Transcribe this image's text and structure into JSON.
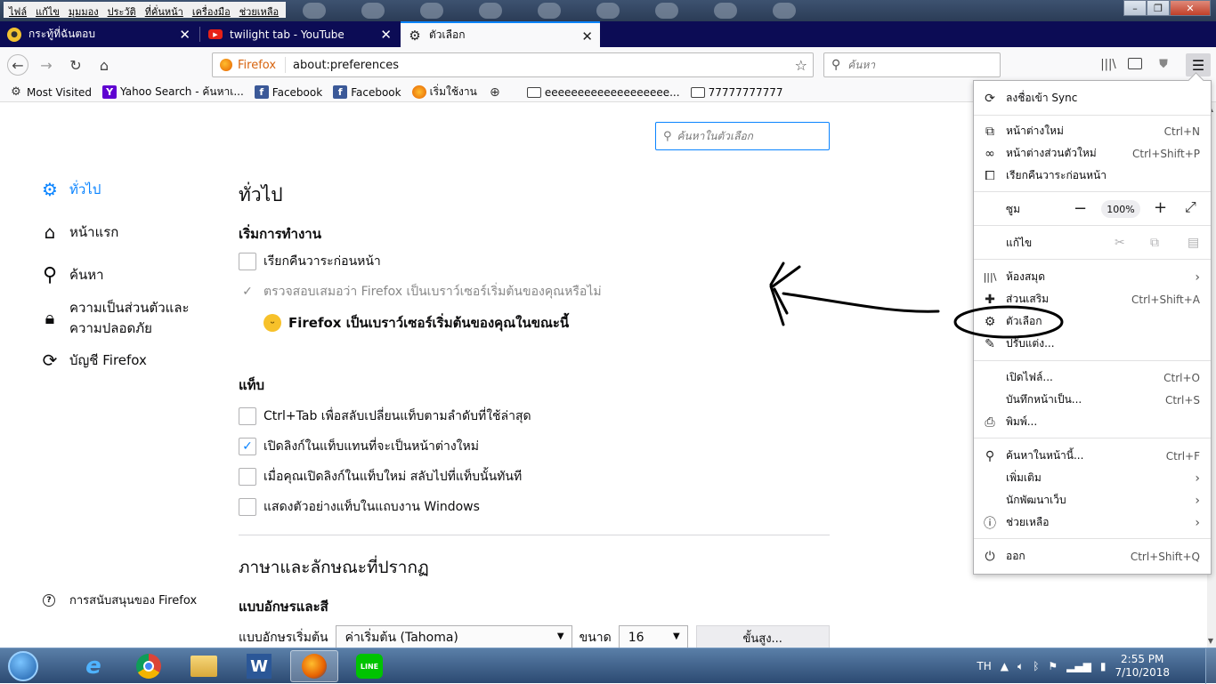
{
  "menubar": {
    "items": [
      "ไฟล์",
      "แก้ไข",
      "มุมมอง",
      "ประวัติ",
      "ที่คั่นหน้า",
      "เครื่องมือ",
      "ช่วยเหลือ"
    ]
  },
  "window_controls": {
    "minimize": "–",
    "maximize": "❐",
    "close": "✕"
  },
  "tabs": [
    {
      "label": "กระทู้ที่ฉันตอบ"
    },
    {
      "label": "twilight tab - YouTube"
    },
    {
      "label": "ตัวเลือก"
    }
  ],
  "newtab_label": "+",
  "navbar": {
    "identity_label": "Firefox",
    "url": "about:preferences",
    "search_placeholder": "ค้นหา"
  },
  "bookmarks": [
    {
      "label": "Most Visited",
      "icon": "gear-icon"
    },
    {
      "label": "Yahoo Search - ค้นหาเ...",
      "icon": "yahoo-icon"
    },
    {
      "label": "Facebook",
      "icon": "facebook-icon"
    },
    {
      "label": "Facebook",
      "icon": "facebook-icon"
    },
    {
      "label": "เริ่มใช้งาน",
      "icon": "firefox-icon"
    },
    {
      "label": "",
      "icon": "globe-icon"
    },
    {
      "label": "eeeeeeeeeeeeeeeeeee...",
      "icon": "folder-icon"
    },
    {
      "label": "77777777777",
      "icon": "folder-icon"
    }
  ],
  "prefs": {
    "search_placeholder": "ค้นหาในตัวเลือก",
    "categories": [
      {
        "label": "ทั่วไป",
        "selected": true
      },
      {
        "label": "หน้าแรก"
      },
      {
        "label": "ค้นหา"
      },
      {
        "label": "ความเป็นส่วนตัวและ\nความปลอดภัย"
      },
      {
        "label": "บัญชี Firefox"
      }
    ],
    "support_label": "การสนับสนุนของ Firefox",
    "heading": "ทั่วไป",
    "startup_heading": "เริ่มการทำงาน",
    "startup_options": [
      {
        "label": "เรียกคืนวาระก่อนหน้า",
        "checked": false
      },
      {
        "label": "ตรวจสอบเสมอว่า Firefox เป็นเบราว์เซอร์เริ่มต้นของคุณหรือไม่",
        "checked": true,
        "disabled": true
      }
    ],
    "default_msg": "Firefox เป็นเบราว์เซอร์เริ่มต้นของคุณในขณะนี้",
    "tabs_heading": "แท็บ",
    "tabs_options": [
      {
        "label": "Ctrl+Tab เพื่อสลับเปลี่ยนแท็บตามลำดับที่ใช้ล่าสุด",
        "checked": false
      },
      {
        "label": "เปิดลิงก์ในแท็บแทนที่จะเป็นหน้าต่างใหม่",
        "checked": true
      },
      {
        "label": "เมื่อคุณเปิดลิงก์ในแท็บใหม่ สลับไปที่แท็บนั้นทันที",
        "checked": false
      },
      {
        "label": "แสดงตัวอย่างแท็บในแถบงาน Windows",
        "checked": false
      }
    ],
    "lang_heading": "ภาษาและลักษณะที่ปรากฏ",
    "fonts_heading": "แบบอักษรและสี",
    "font_label": "แบบอักษรเริ่มต้น",
    "font_value": "ค่าเริ่มต้น (Tahoma)",
    "size_label": "ขนาด",
    "size_value": "16",
    "advanced_label": "ขั้นสูง..."
  },
  "appmenu": {
    "sync": "ลงชื่อเข้า Sync",
    "new_window": {
      "label": "หน้าต่างใหม่",
      "shortcut": "Ctrl+N"
    },
    "private_window": {
      "label": "หน้าต่างส่วนตัวใหม่",
      "shortcut": "Ctrl+Shift+P"
    },
    "restore": "เรียกคืนวาระก่อนหน้า",
    "zoom_label": "ซูม",
    "zoom_value": "100%",
    "edit_label": "แก้ไข",
    "library": "ห้องสมุด",
    "addons": {
      "label": "ส่วนเสริม",
      "shortcut": "Ctrl+Shift+A"
    },
    "options": "ตัวเลือก",
    "customize": "ปรับแต่ง...",
    "open_file": {
      "label": "เปิดไฟล์...",
      "shortcut": "Ctrl+O"
    },
    "save_page": {
      "label": "บันทึกหน้าเป็น...",
      "shortcut": "Ctrl+S"
    },
    "print": "พิมพ์...",
    "find": {
      "label": "ค้นหาในหน้านี้...",
      "shortcut": "Ctrl+F"
    },
    "more": "เพิ่มเติม",
    "web_dev": "นักพัฒนาเว็บ",
    "help": "ช่วยเหลือ",
    "quit": {
      "label": "ออก",
      "shortcut": "Ctrl+Shift+Q"
    }
  },
  "taskbar": {
    "apps": [
      "internet-explorer",
      "chrome",
      "file-explorer",
      "word",
      "firefox",
      "line"
    ],
    "line_label": "LINE",
    "word_label": "W",
    "lang": "TH",
    "time": "2:55 PM",
    "date": "7/10/2018"
  }
}
